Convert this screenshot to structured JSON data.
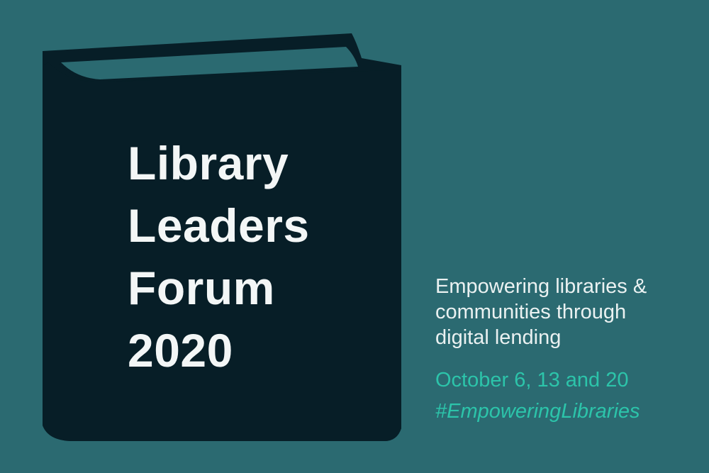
{
  "colors": {
    "background": "#2b6a71",
    "book_cover": "#071e27",
    "title_text": "#f3f6f6",
    "tagline_text": "#eaf1f1",
    "accent": "#2cc4aa"
  },
  "book": {
    "icon": "book-icon",
    "title_lines": [
      "Library",
      "Leaders",
      "Forum",
      "2020"
    ]
  },
  "info": {
    "tagline_lines": [
      "Empowering libraries &",
      "communities through",
      "digital lending"
    ],
    "dates": "October 6, 13 and 20",
    "hashtag": "#EmpoweringLibraries"
  }
}
